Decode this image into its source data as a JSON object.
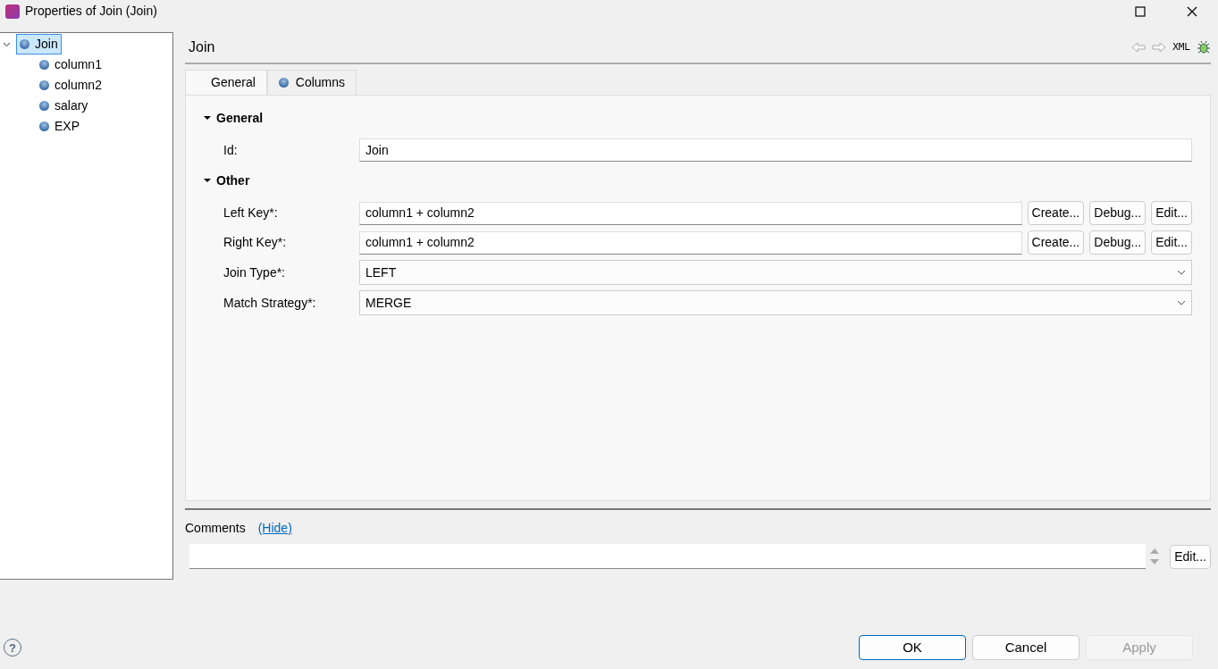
{
  "window": {
    "title": "Properties of Join (Join)"
  },
  "tree": [
    {
      "label": "Join",
      "selected": true,
      "expanded": true,
      "children": [
        {
          "label": "column1",
          "selected": false
        },
        {
          "label": "column2",
          "selected": false
        },
        {
          "label": "salary",
          "selected": false
        },
        {
          "label": "EXP",
          "selected": false
        }
      ]
    }
  ],
  "header": {
    "title": "Join",
    "toolbar_text": "XML"
  },
  "tabs": [
    {
      "label": "General",
      "selected": true,
      "icon": false
    },
    {
      "label": "Columns",
      "selected": false,
      "icon": true
    }
  ],
  "sections": [
    {
      "title": "General",
      "expanded": true,
      "fields": [
        {
          "kind": "text",
          "label": "Id:",
          "value": "Join"
        }
      ]
    },
    {
      "title": "Other",
      "expanded": true,
      "fields": [
        {
          "kind": "text",
          "label": "Left Key*:",
          "value": "column1 + column2",
          "buttons": [
            "Create...",
            "Debug...",
            "Edit..."
          ]
        },
        {
          "kind": "text",
          "label": "Right Key*:",
          "value": "column1 + column2",
          "buttons": [
            "Create...",
            "Debug...",
            "Edit..."
          ]
        },
        {
          "kind": "select",
          "label": "Join Type*:",
          "value": "LEFT"
        },
        {
          "kind": "select",
          "label": "Match Strategy*:",
          "value": "MERGE"
        }
      ]
    }
  ],
  "comments": {
    "label": "Comments",
    "link": "(Hide)",
    "edit_button": "Edit..."
  },
  "help": "?",
  "buttons": [
    {
      "label": "OK",
      "default": true,
      "disabled": false
    },
    {
      "label": "Cancel",
      "default": false,
      "disabled": false
    },
    {
      "label": "Apply",
      "default": false,
      "disabled": true
    }
  ]
}
